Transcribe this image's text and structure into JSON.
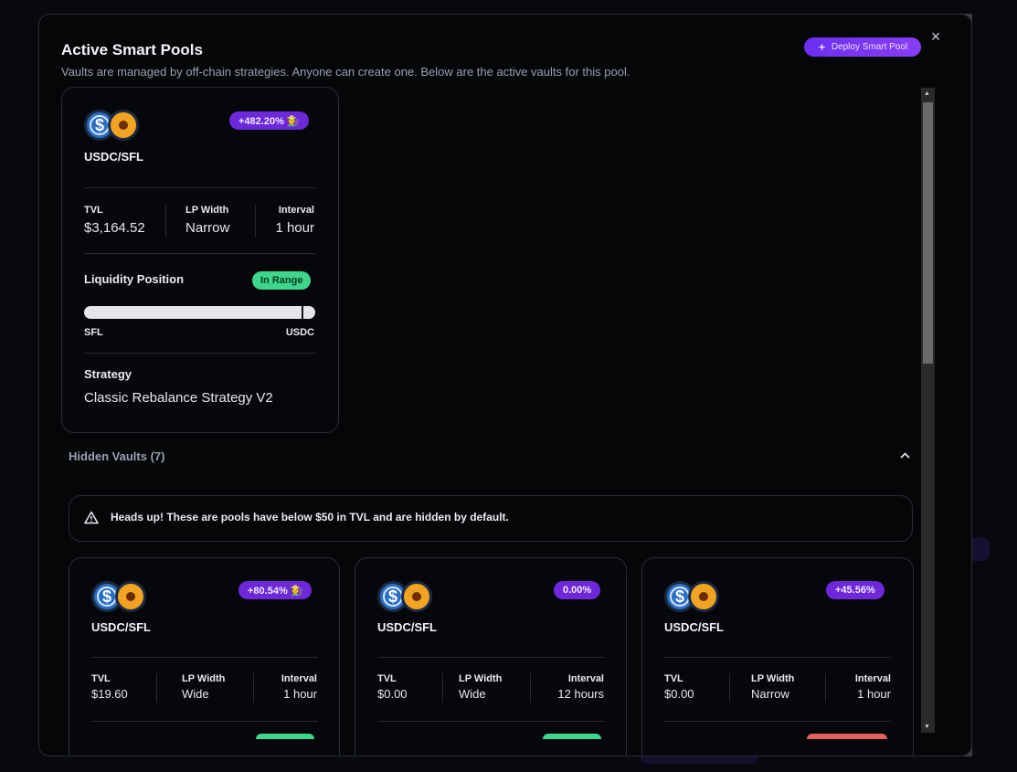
{
  "modal": {
    "title": "Active Smart Pools",
    "subtitle": "Vaults are managed by off-chain strategies. Anyone can create one. Below are the active vaults for this pool.",
    "deploy_label": "Deploy Smart Pool",
    "close_glyph": "×"
  },
  "active_vault": {
    "pair": "USDC/SFL",
    "apr": "+482.20% 🧑‍🌾",
    "tvl_label": "TVL",
    "tvl": "$3,164.52",
    "lp_width_label": "LP Width",
    "lp_width": "Narrow",
    "interval_label": "Interval",
    "interval": "1 hour",
    "liquidity_label": "Liquidity Position",
    "range_status": "In Range",
    "range_left": "SFL",
    "range_right": "USDC",
    "range_position": 0.94,
    "strategy_label": "Strategy",
    "strategy": "Classic Rebalance Strategy V2"
  },
  "hidden": {
    "header": "Hidden Vaults (7)",
    "alert": "Heads up! These are pools have below $50 in TVL and are hidden by default.",
    "vaults": [
      {
        "pair": "USDC/SFL",
        "apr": "+80.54% 🧑‍🌾",
        "tvl_label": "TVL",
        "tvl": "$19.60",
        "lp_width_label": "LP Width",
        "lp_width": "Wide",
        "interval_label": "Interval",
        "interval": "1 hour"
      },
      {
        "pair": "USDC/SFL",
        "apr": "0.00%",
        "tvl_label": "TVL",
        "tvl": "$0.00",
        "lp_width_label": "LP Width",
        "lp_width": "Wide",
        "interval_label": "Interval",
        "interval": "12 hours"
      },
      {
        "pair": "USDC/SFL",
        "apr": "+45.56%",
        "tvl_label": "TVL",
        "tvl": "$0.00",
        "lp_width_label": "LP Width",
        "lp_width": "Narrow",
        "interval_label": "Interval",
        "interval": "1 hour"
      }
    ]
  },
  "icons": {
    "usdc": "$",
    "close": "close-icon",
    "chevron": "chevron-up-icon",
    "warning": "warning-icon",
    "sparkle": "sparkle-icon"
  },
  "colors": {
    "accent": "#6d28d9",
    "in_range": "#3dd68c",
    "out_of_range": "#e4605e"
  }
}
